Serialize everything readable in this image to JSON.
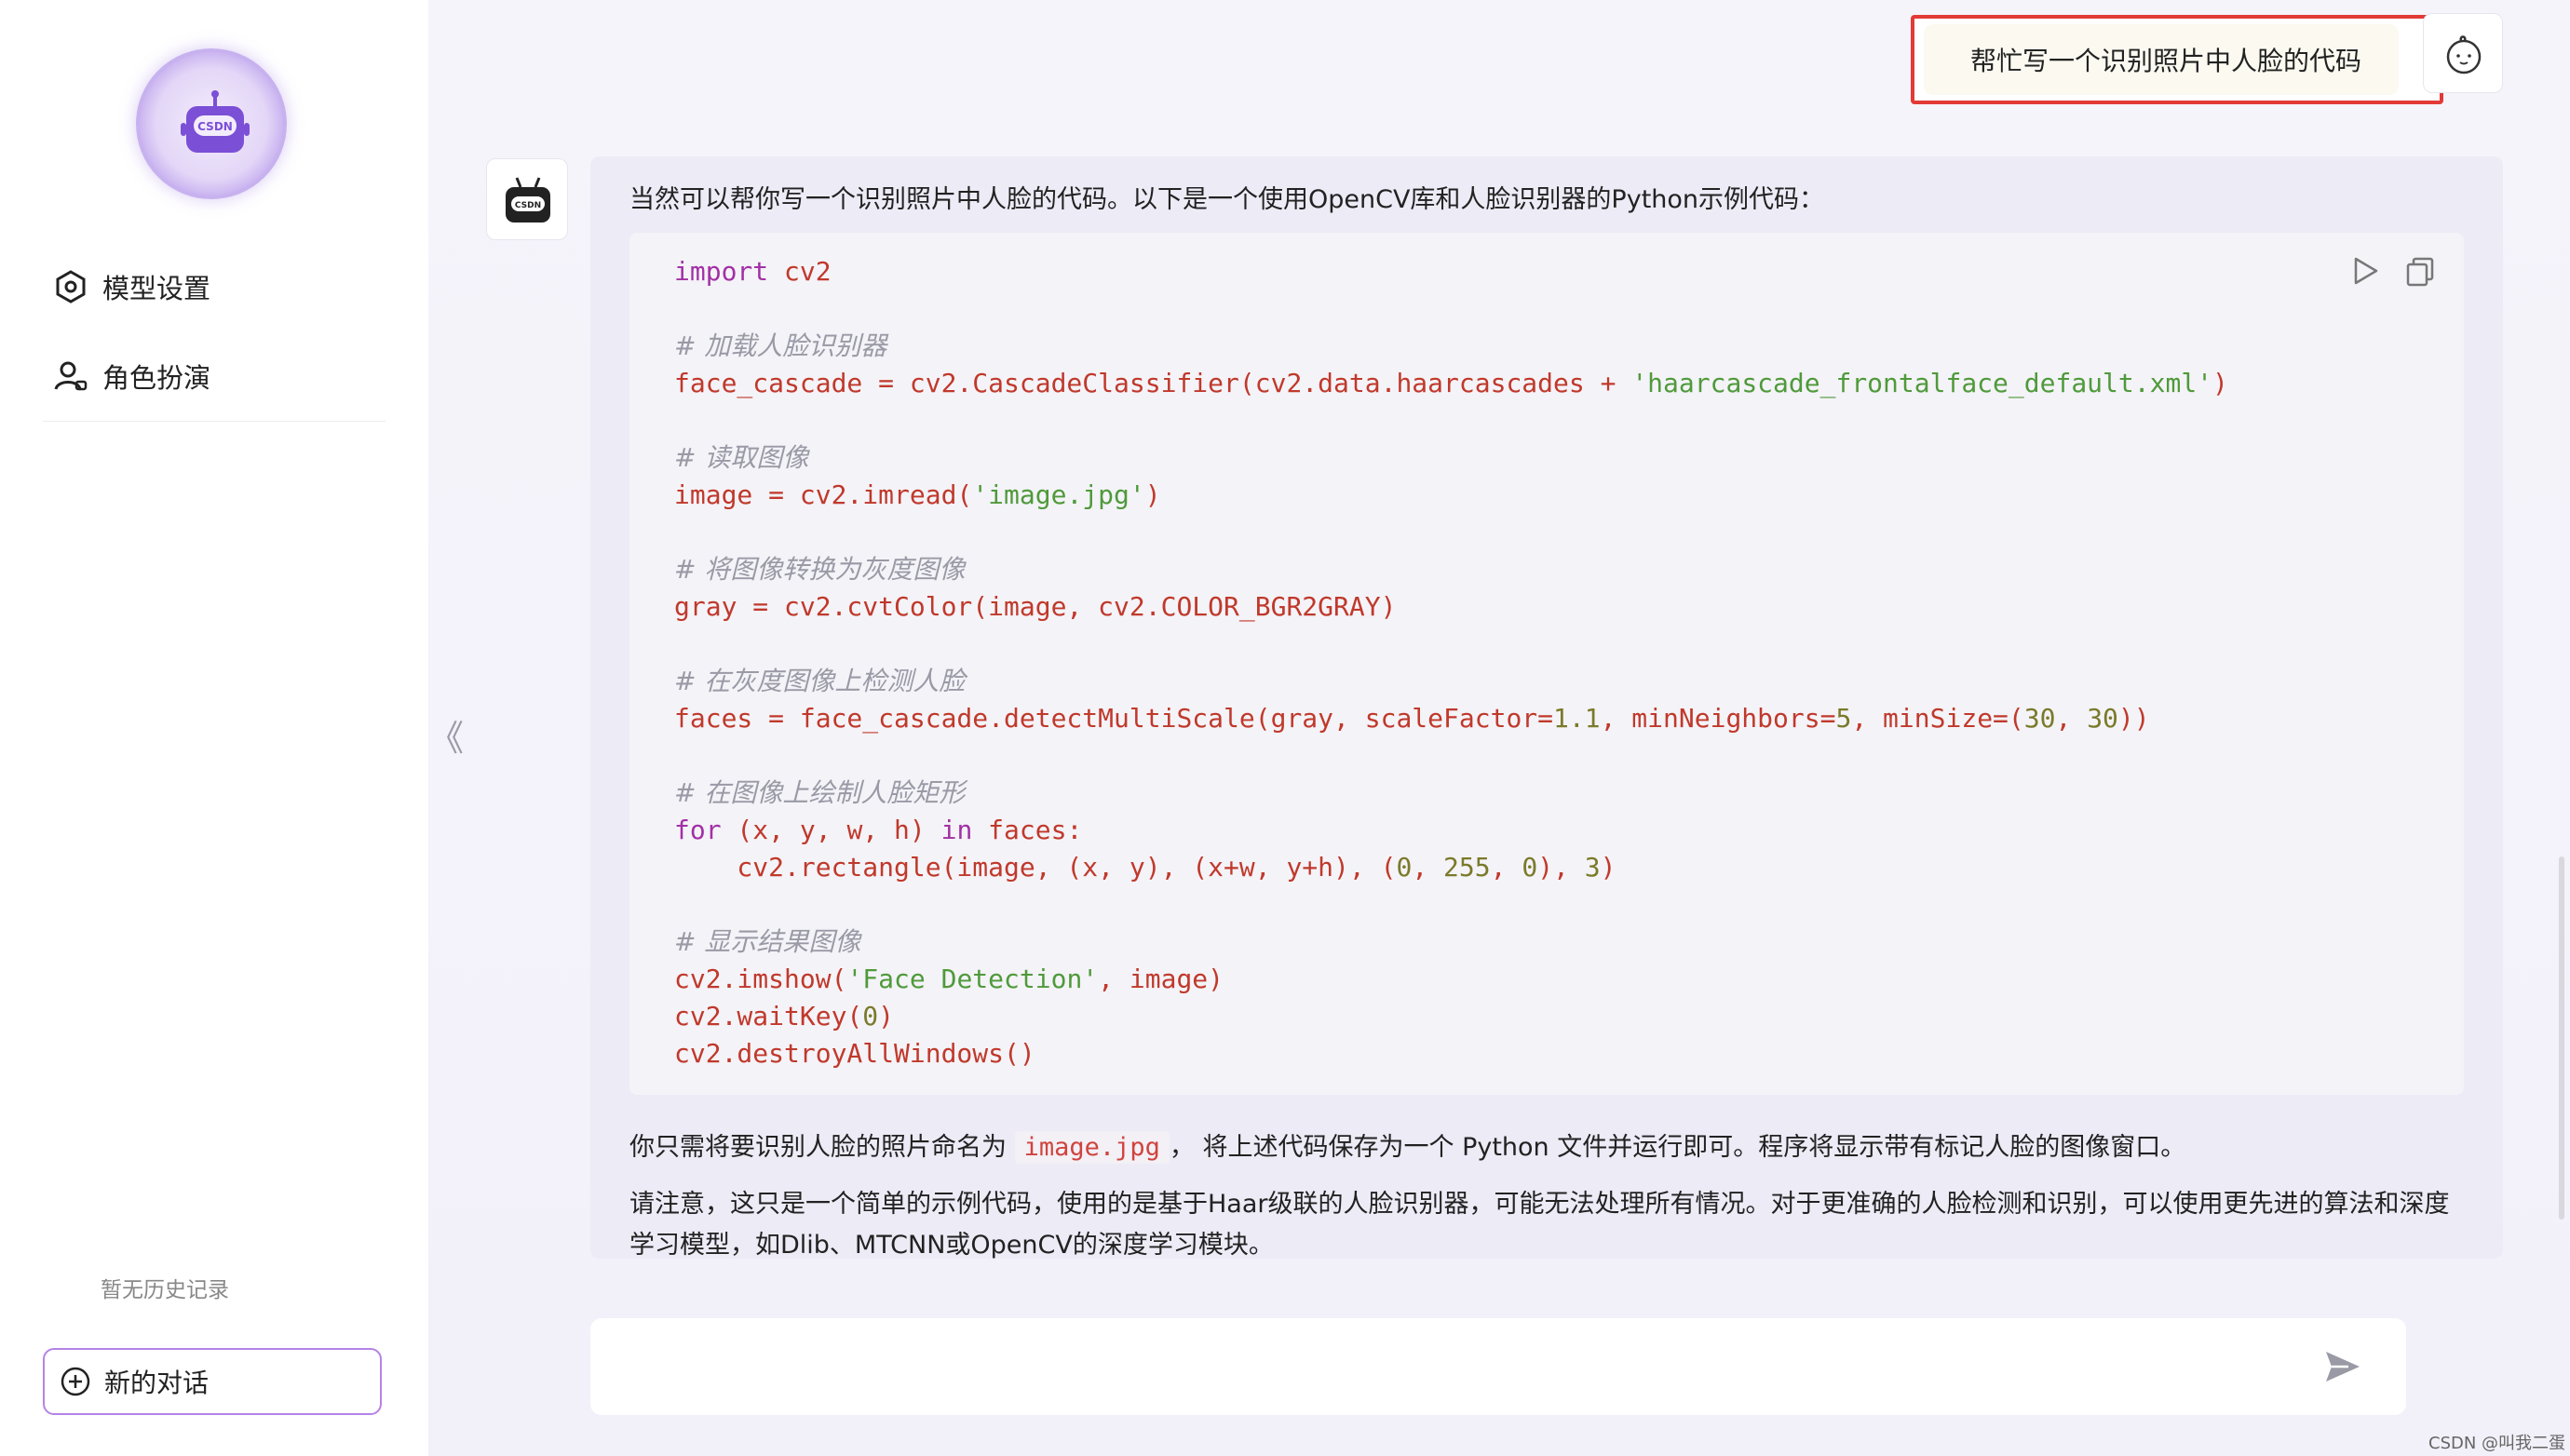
{
  "sidebar": {
    "menu": [
      {
        "label": "模型设置",
        "icon": "settings-icon"
      },
      {
        "label": "角色扮演",
        "icon": "user-role-icon"
      }
    ],
    "no_history": "暂无历史记录",
    "new_chat": "新的对话"
  },
  "chat": {
    "user_message": "帮忙写一个识别照片中人脸的代码",
    "intro": "当然可以帮你写一个识别照片中人脸的代码。以下是一个使用OpenCV库和人脸识别器的Python示例代码：",
    "code_lines": [
      "import cv2",
      "",
      "# 加载人脸识别器",
      "face_cascade = cv2.CascadeClassifier(cv2.data.haarcascades + 'haarcascade_frontalface_default.xml')",
      "",
      "# 读取图像",
      "image = cv2.imread('image.jpg')",
      "",
      "# 将图像转换为灰度图像",
      "gray = cv2.cvtColor(image, cv2.COLOR_BGR2GRAY)",
      "",
      "# 在灰度图像上检测人脸",
      "faces = face_cascade.detectMultiScale(gray, scaleFactor=1.1, minNeighbors=5, minSize=(30, 30))",
      "",
      "# 在图像上绘制人脸矩形",
      "for (x, y, w, h) in faces:",
      "    cv2.rectangle(image, (x, y), (x+w, y+h), (0, 255, 0), 3)",
      "",
      "# 显示结果图像",
      "cv2.imshow('Face Detection', image)",
      "cv2.waitKey(0)",
      "cv2.destroyAllWindows()"
    ],
    "para1_before": "你只需将要识别人脸的照片命名为 ",
    "para1_code": "image.jpg",
    "para1_after": "， 将上述代码保存为一个 Python 文件并运行即可。程序将显示带有标记人脸的图像窗口。",
    "para2": "请注意，这只是一个简单的示例代码，使用的是基于Haar级联的人脸识别器，可能无法处理所有情况。对于更准确的人脸检测和识别，可以使用更先进的算法和深度学习模型，如Dlib、MTCNN或OpenCV的深度学习模块。"
  },
  "input": {
    "placeholder": ""
  },
  "footer_watermark": "CSDN @叫我二蛋",
  "colors": {
    "accent": "#b583e6",
    "highlight_border": "#e23a36"
  }
}
